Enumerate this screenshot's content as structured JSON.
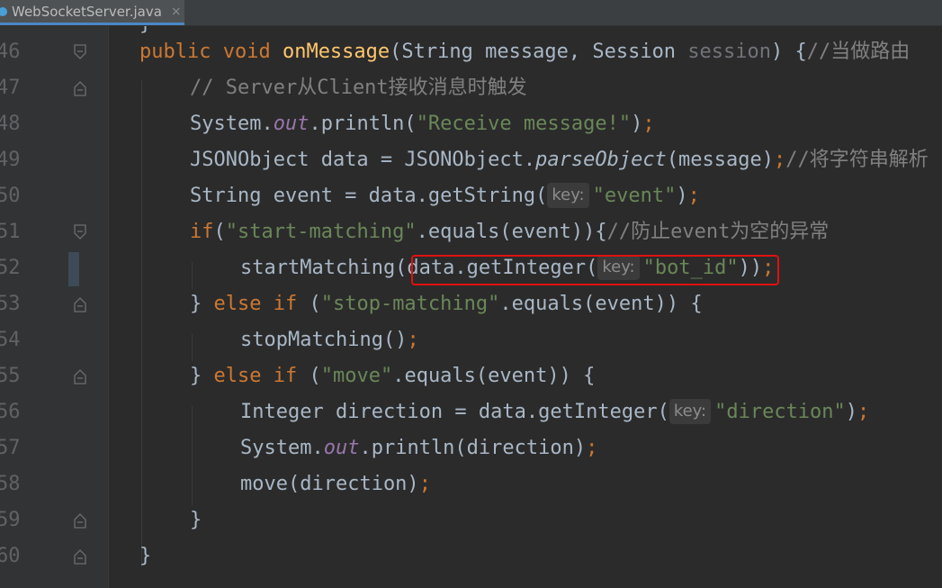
{
  "tab": {
    "filename": "WebSocketServer.java",
    "close": "×"
  },
  "editor": {
    "top_partial": "}",
    "lines": [
      {
        "num": "46",
        "fold": "open"
      },
      {
        "num": "47",
        "fold": "open-minus"
      },
      {
        "num": "48",
        "fold": "none"
      },
      {
        "num": "49",
        "fold": "none"
      },
      {
        "num": "50",
        "fold": "none"
      },
      {
        "num": "51",
        "fold": "open"
      },
      {
        "num": "52",
        "fold": "none"
      },
      {
        "num": "53",
        "fold": "minus"
      },
      {
        "num": "54",
        "fold": "none"
      },
      {
        "num": "55",
        "fold": "minus"
      },
      {
        "num": "56",
        "fold": "none"
      },
      {
        "num": "57",
        "fold": "none"
      },
      {
        "num": "58",
        "fold": "none"
      },
      {
        "num": "59",
        "fold": "minus"
      },
      {
        "num": "60",
        "fold": "minus"
      }
    ],
    "code": {
      "l46": {
        "kw1": "public void ",
        "fn": "onMessage",
        "p1": "(String message, Session ",
        "param": "session",
        "p2": ") {",
        "cm": "//当做路由"
      },
      "l47": {
        "cm": "// Server从Client接收消息时触发"
      },
      "l48": {
        "a": "System.",
        "fld": "out",
        "b": ".println(",
        "str": "\"Receive message!\"",
        "c": ")",
        "sc": ";"
      },
      "l49": {
        "a": "JSONObject data = JSONObject.",
        "it": "parseObject",
        "b": "(message)",
        "sc": ";",
        "cm": "//将字符串解析"
      },
      "l50": {
        "a": "String event = data.getString(",
        "hint": "key:",
        "str": "\"event\"",
        "b": ")",
        "sc": ";"
      },
      "l51": {
        "kw": "if",
        "a": "(",
        "str": "\"start-matching\"",
        "b": ".equals(event)){",
        "cm": "//防止event为空的异常"
      },
      "l52": {
        "a": "startMatching(data.getInteger(",
        "hint": "key:",
        "str": "\"bot_id\"",
        "b": "))",
        "sc": ";"
      },
      "l53": {
        "a": "} ",
        "kw": "else if",
        "b": " (",
        "str": "\"stop-matching\"",
        "c": ".equals(event)) {"
      },
      "l54": {
        "a": "stopMatching()",
        "sc": ";"
      },
      "l55": {
        "a": "} ",
        "kw": "else if",
        "b": " (",
        "str": "\"move\"",
        "c": ".equals(event)) {"
      },
      "l56": {
        "a": "Integer direction = data.getInteger(",
        "hint": "key:",
        "str": "\"direction\"",
        "b": ")",
        "sc": ";"
      },
      "l57": {
        "a": "System.",
        "fld": "out",
        "b": ".println(direction)",
        "sc": ";"
      },
      "l58": {
        "a": "move(direction)",
        "sc": ";"
      },
      "l59": {
        "a": "}"
      },
      "l60": {
        "a": "}"
      }
    }
  },
  "colors": {
    "background": "#2b2b2b",
    "gutter": "#313335",
    "keyword": "#cc7832",
    "function": "#ffc66d",
    "string": "#6a8759",
    "comment": "#808080",
    "field": "#9876aa",
    "highlight_box": "#e01010"
  }
}
